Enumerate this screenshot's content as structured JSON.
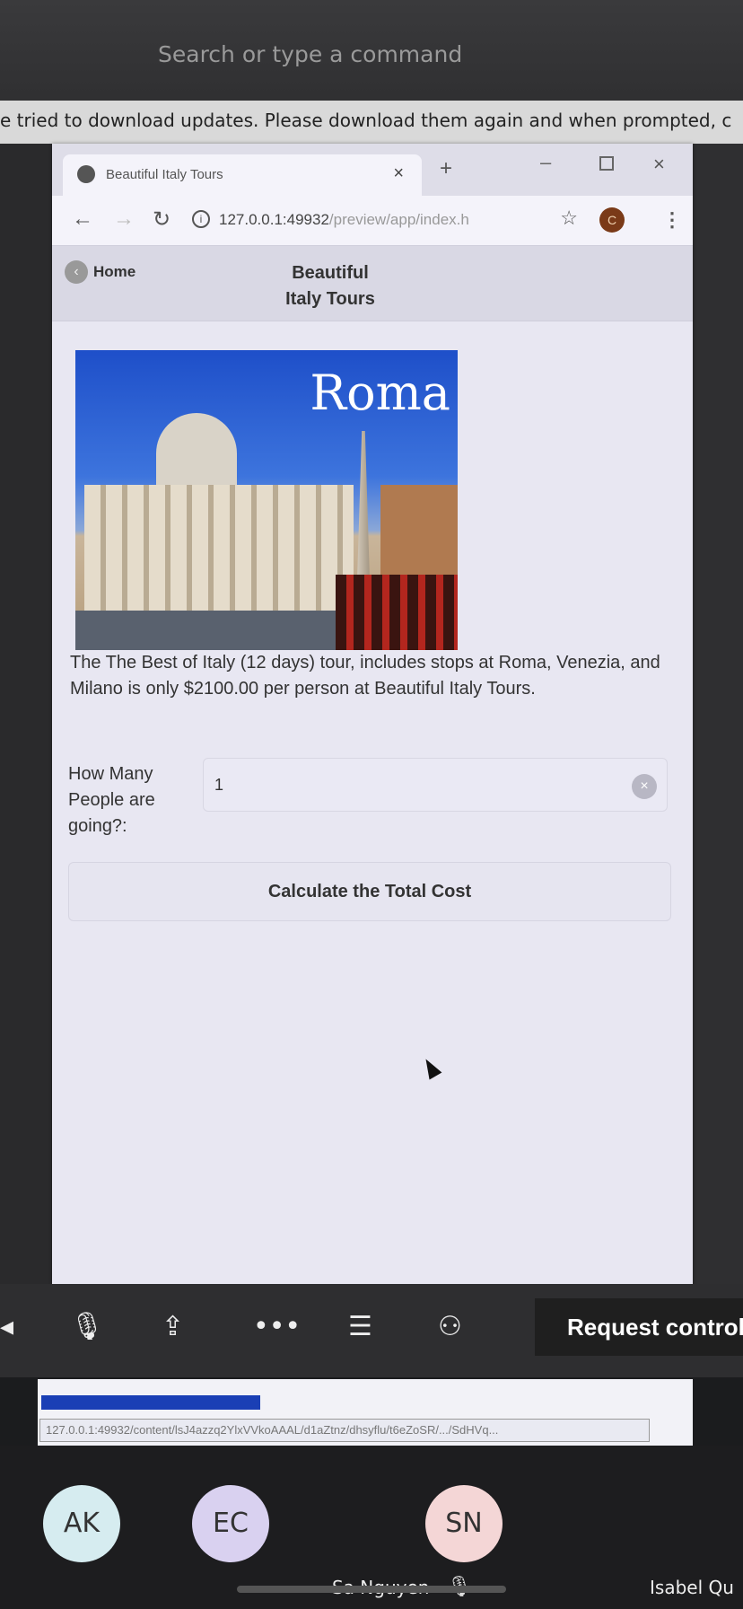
{
  "teams": {
    "search_placeholder": "Search or type a command",
    "update_banner": "e tried to download updates. Please download them again and when prompted, c",
    "request_control": "Request control"
  },
  "browser": {
    "tab_title": "Beautiful Italy Tours",
    "url_host": "127.0.0.1:49932",
    "url_path": "/preview/app/index.h",
    "profile_initial": "C"
  },
  "app": {
    "home_label": "Home",
    "title_line1": "Beautiful",
    "title_line2": "Italy Tours",
    "hero_label": "Roma",
    "description": "The The Best of Italy (12 days) tour, includes stops at Roma, Venezia, and Milano is only $2100.00 per person at Beautiful Italy Tours.",
    "qty_label": "How Many People are going?:",
    "qty_value": "1",
    "calc_button": "Calculate the Total Cost"
  },
  "status": {
    "progress_percent": 33,
    "url": "127.0.0.1:49932/content/lsJ4azzq2YlxVVkoAAAL/d1aZtnz/dhsyflu/t6eZoSR/.../SdHVq..."
  },
  "participants": [
    {
      "initials": "AK",
      "color": "#d6ecf0"
    },
    {
      "initials": "EC",
      "color": "#d9d1f0"
    },
    {
      "initials": "SN",
      "color": "#f4d6d6",
      "name": "Sa Nguyen"
    }
  ],
  "extra_name": "Isabel Qu",
  "colors": {
    "progress": "#1a3fb5",
    "app_header": "#d9d8e4",
    "page_bg": "#e8e7f2"
  }
}
